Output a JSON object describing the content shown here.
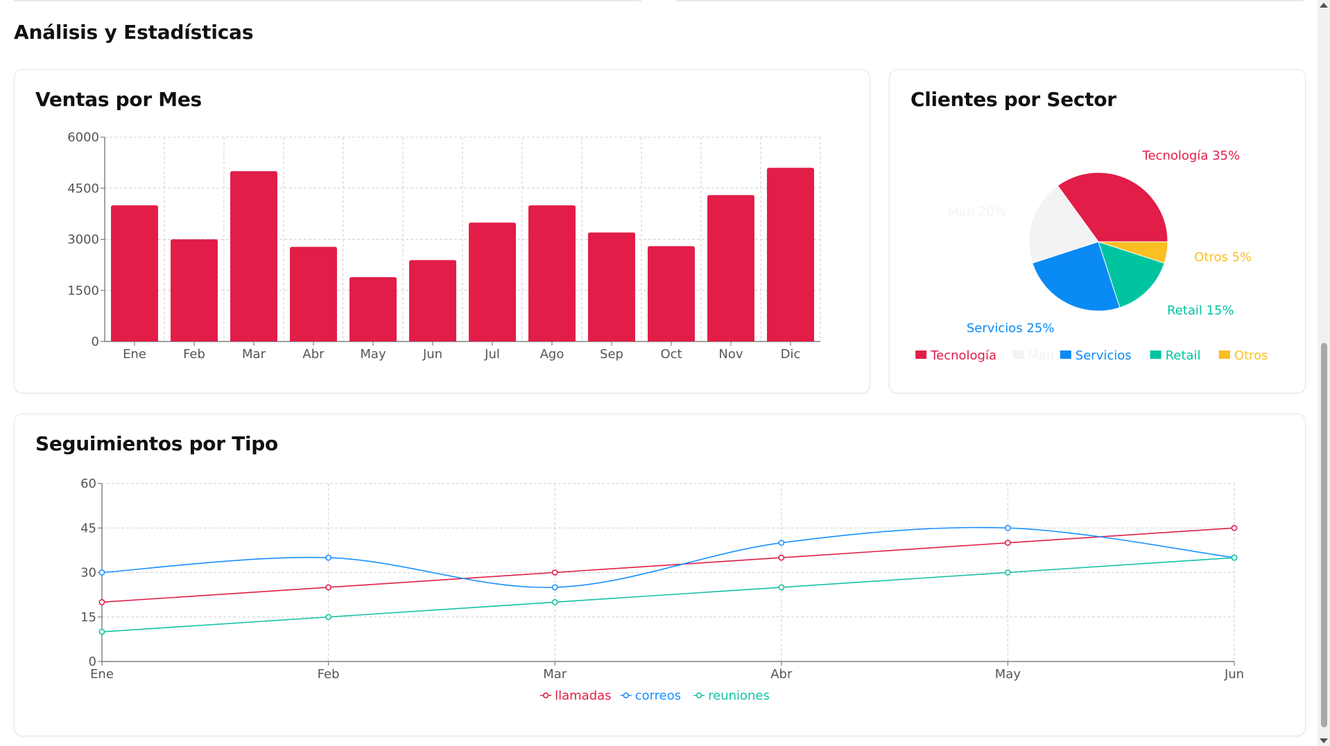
{
  "page": {
    "section_title": "Análisis y Estadísticas"
  },
  "colors": {
    "primary": "#e11d48",
    "blue": "#1890ff",
    "teal": "#13c2a3",
    "grid": "#cfcfcf",
    "axis": "#666666",
    "tick_text": "#555555"
  },
  "cards": {
    "sales": {
      "title": "Ventas por Mes"
    },
    "clients": {
      "title": "Clientes por Sector"
    },
    "followups": {
      "title": "Seguimientos por Tipo"
    }
  },
  "chart_data": [
    {
      "id": "ventas",
      "type": "bar",
      "title": "Ventas por Mes",
      "categories": [
        "Ene",
        "Feb",
        "Mar",
        "Abr",
        "May",
        "Jun",
        "Jul",
        "Ago",
        "Sep",
        "Oct",
        "Nov",
        "Dic"
      ],
      "values": [
        4000,
        3000,
        5000,
        2780,
        1890,
        2390,
        3490,
        4000,
        3200,
        2800,
        4300,
        5100
      ],
      "color": "#e11d48",
      "ylim": [
        0,
        6000
      ],
      "yticks": [
        0,
        1500,
        3000,
        4500,
        6000
      ],
      "grid": true
    },
    {
      "id": "clientes",
      "type": "pie",
      "title": "Clientes por Sector",
      "slices": [
        {
          "name": "Tecnología",
          "value": 35,
          "label": "Tecnología 35%",
          "color": "#e11d48"
        },
        {
          "name": "Man",
          "value": 20,
          "label": "Man 20%",
          "color": "#f3f3f3"
        },
        {
          "name": "Servicios",
          "value": 25,
          "label": "Servicios 25%",
          "color": "#0a8af5"
        },
        {
          "name": "Retail",
          "value": 15,
          "label": "Retail 15%",
          "color": "#00c49f"
        },
        {
          "name": "Otros",
          "value": 5,
          "label": "Otros 5%",
          "color": "#fbbf24"
        }
      ],
      "legend": "bottom"
    },
    {
      "id": "seguimientos",
      "type": "line",
      "title": "Seguimientos por Tipo",
      "categories": [
        "Ene",
        "Feb",
        "Mar",
        "Abr",
        "May",
        "Jun"
      ],
      "series": [
        {
          "name": "llamadas",
          "values": [
            20,
            25,
            30,
            35,
            40,
            45
          ],
          "color": "#e11d48",
          "curve": "linear"
        },
        {
          "name": "correos",
          "values": [
            30,
            35,
            25,
            40,
            45,
            35
          ],
          "color": "#1890ff",
          "curve": "smooth"
        },
        {
          "name": "reuniones",
          "values": [
            10,
            15,
            20,
            25,
            30,
            35
          ],
          "color": "#13c2a3",
          "curve": "linear"
        }
      ],
      "ylim": [
        0,
        60
      ],
      "yticks": [
        0,
        15,
        30,
        45,
        60
      ],
      "grid": true,
      "legend": "bottom"
    }
  ]
}
